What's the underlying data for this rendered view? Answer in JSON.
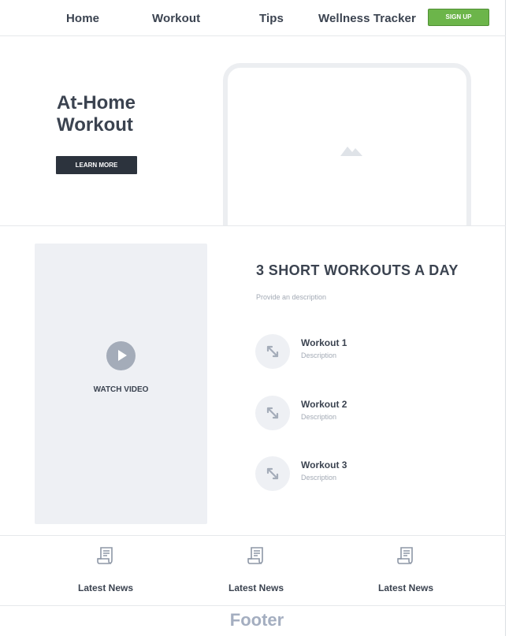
{
  "nav": {
    "items": [
      "Home",
      "Workout",
      "Tips",
      "Wellness Tracker"
    ],
    "signup_label": "SIGN UP"
  },
  "hero": {
    "title_line1": "At-Home",
    "title_line2": "Workout",
    "cta_label": "LEARN MORE",
    "image_icon": "image-placeholder-icon"
  },
  "video": {
    "play_icon": "play-icon",
    "label": "WATCH VIDEO"
  },
  "workouts": {
    "title": "3 SHORT WORKOUTS A DAY",
    "description": "Provide an description",
    "items": [
      {
        "title": "Workout 1",
        "description": "Description",
        "icon": "expand-arrows-icon"
      },
      {
        "title": "Workout 2",
        "description": "Description",
        "icon": "expand-arrows-icon"
      },
      {
        "title": "Workout 3",
        "description": "Description",
        "icon": "expand-arrows-icon"
      }
    ]
  },
  "news": {
    "items": [
      {
        "label": "Latest News",
        "icon": "newspaper-icon"
      },
      {
        "label": "Latest News",
        "icon": "newspaper-icon"
      },
      {
        "label": "Latest News",
        "icon": "newspaper-icon"
      }
    ]
  },
  "footer": {
    "label": "Footer"
  },
  "colors": {
    "accent_green": "#6cb54a",
    "dark_button": "#2c333d",
    "placeholder_bg": "#eef0f4",
    "text_dark": "#3b4350",
    "text_muted": "#a3aab5"
  }
}
